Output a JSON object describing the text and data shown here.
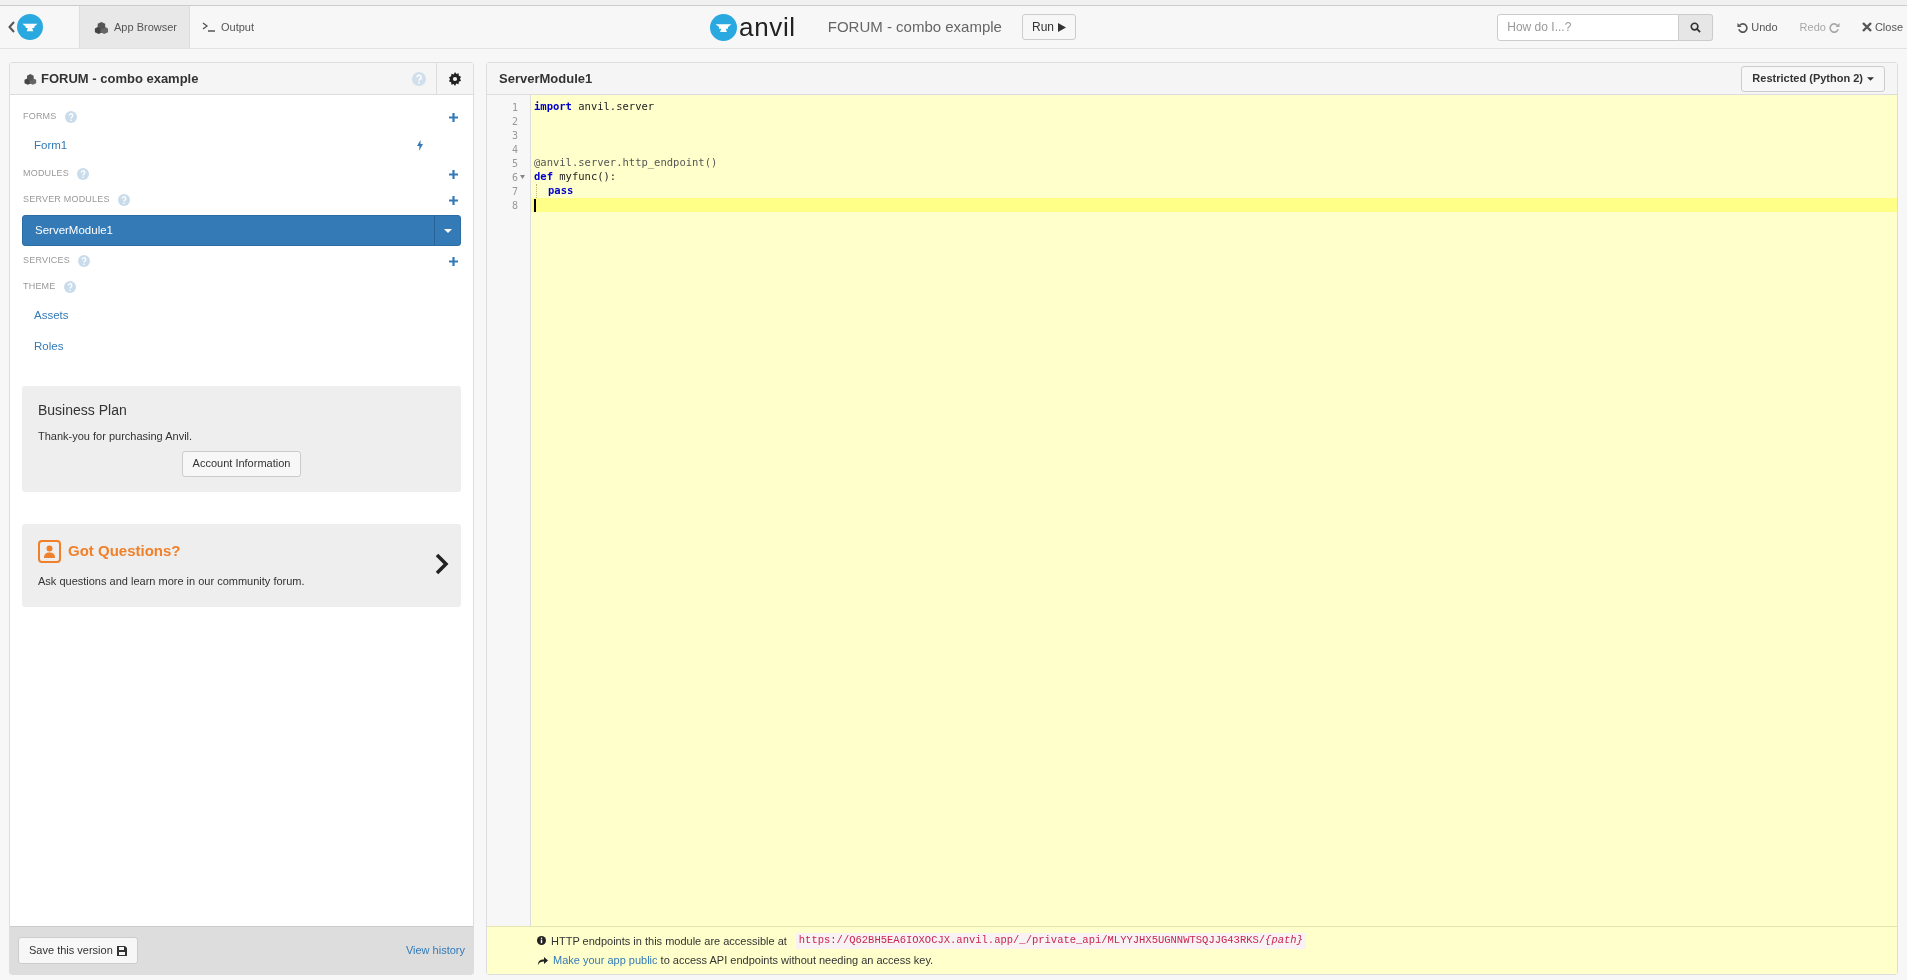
{
  "topbar": {
    "tabs": [
      {
        "label": "App Browser",
        "selected": true
      },
      {
        "label": "Output",
        "selected": false
      }
    ],
    "logo_text": "anvil",
    "app_title": "FORUM - combo example",
    "run_button": "Run",
    "search": {
      "placeholder": "How do I...?"
    },
    "actions": [
      {
        "label": "Undo",
        "disabled": false
      },
      {
        "label": "Redo",
        "disabled": true
      },
      {
        "label": "Close",
        "disabled": false
      }
    ]
  },
  "sidebar": {
    "title": "FORUM - combo example",
    "entries": [
      {
        "kind": "header",
        "label": "FORMS",
        "add": true
      },
      {
        "kind": "item",
        "label": "Form1",
        "selected": false,
        "startup": true
      },
      {
        "kind": "header",
        "label": "MODULES",
        "add": true
      },
      {
        "kind": "header",
        "label": "SERVER MODULES",
        "add": true
      },
      {
        "kind": "item",
        "label": "ServerModule1",
        "selected": true,
        "startup": false
      },
      {
        "kind": "header",
        "label": "SERVICES",
        "add": true
      },
      {
        "kind": "header",
        "label": "THEME",
        "add": false
      },
      {
        "kind": "item",
        "label": "Assets",
        "selected": false,
        "startup": false
      },
      {
        "kind": "item",
        "label": "Roles",
        "selected": false,
        "startup": false
      }
    ],
    "plan_card": {
      "title": "Business Plan",
      "text": "Thank-you for purchasing Anvil.",
      "button": "Account Information"
    },
    "questions_card": {
      "title": "Got Questions?",
      "text": "Ask questions and learn more in our community forum."
    },
    "save_button": "Save this version",
    "history_link": "View history"
  },
  "editor": {
    "title": "ServerModule1",
    "python_version": "Restricted (Python 2)",
    "lines": [
      {
        "number": "1",
        "active": false,
        "tokens": [
          {
            "kind": "keyword",
            "text": "import"
          },
          {
            "kind": "plain",
            "text": " anvil.server"
          }
        ]
      },
      {
        "number": "2",
        "active": false
      },
      {
        "number": "3",
        "active": false
      },
      {
        "number": "4",
        "active": false
      },
      {
        "number": "5",
        "active": false,
        "tokens": [
          {
            "kind": "decorator",
            "text": "@anvil.server.http_endpoint()"
          }
        ]
      },
      {
        "number": "6",
        "active": false,
        "foldable": true,
        "tokens": [
          {
            "kind": "keyword",
            "text": "def"
          },
          {
            "kind": "plain",
            "text": " myfunc():"
          }
        ]
      },
      {
        "number": "7",
        "active": false,
        "indent": true,
        "tokens": [
          {
            "kind": "keyword",
            "text": "pass"
          }
        ]
      },
      {
        "number": "8",
        "active": true
      }
    ],
    "footer": {
      "endpoint_text": "HTTP endpoints in this module are accessible at",
      "url": "https://Q62BH5EA6IOXOCJX.anvil.app/_/private_api/MLYYJHX5UGNNWTSQJJG43RKS/",
      "url_path": "{path}",
      "public_link": "Make your app public",
      "public_text": "to access API endpoints without needing an access key."
    }
  }
}
